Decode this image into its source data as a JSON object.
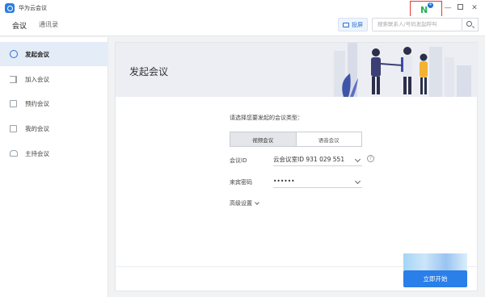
{
  "window": {
    "title": "华为云会议"
  },
  "titlebar": {
    "ext_badge": "4",
    "minimize": "—",
    "close": "✕"
  },
  "toolbar": {
    "tabs": [
      {
        "label": "会议"
      },
      {
        "label": "通讯录"
      }
    ],
    "cast_label": "投屏",
    "search_placeholder": "搜索联系人/号码发起呼叫"
  },
  "sidebar": {
    "items": [
      {
        "label": "发起会议",
        "icon": "phone-icon",
        "active": true
      },
      {
        "label": "加入会议",
        "icon": "join-icon"
      },
      {
        "label": "预约会议",
        "icon": "calendar-icon"
      },
      {
        "label": "我的会议",
        "icon": "list-icon"
      },
      {
        "label": "主持会议",
        "icon": "people-icon"
      }
    ]
  },
  "main": {
    "banner_title": "发起会议",
    "prompt": "请选择您要发起的会议类型：",
    "meeting_types": [
      {
        "label": "视频会议",
        "selected": true
      },
      {
        "label": "语音会议"
      }
    ],
    "meeting_id_label": "会议ID",
    "meeting_id_value": "云会议室ID 931 029 551",
    "password_label": "来宾密码",
    "password_value": "••••••",
    "help_glyph": "?",
    "advanced_label": "高级设置",
    "start_button": "立即开始"
  },
  "colors": {
    "accent": "#2a7fe8",
    "highlight_box": "#e53935",
    "ext_icon": "#27b05c"
  }
}
